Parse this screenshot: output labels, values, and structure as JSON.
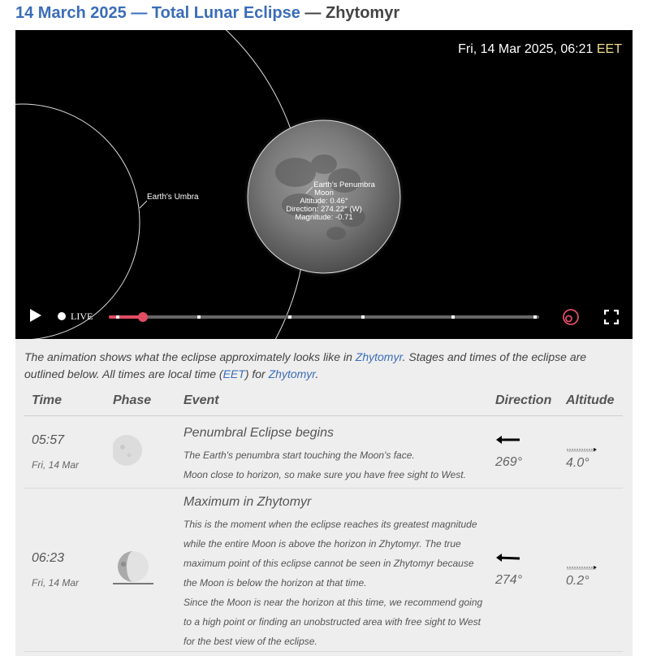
{
  "title": {
    "link_text": "14 March 2025 — Total Lunar Eclipse",
    "rest_text": " — Zhytomyr"
  },
  "player": {
    "datetime": "Fri, 14 Mar 2025, 06:21",
    "timezone": "EET",
    "umbra_label": "Earth's Umbra",
    "moon_label": "Moon",
    "penumbra_label": "Earth's Penumbra",
    "altitude": "Altitude: 0.46°",
    "direction": "Direction: 274.22° (W)",
    "magnitude": "Magnitude: -0.71",
    "live_label": "LIVE",
    "progress": 0.08,
    "stage_marks": [
      0.02,
      0.21,
      0.42,
      0.59,
      0.8,
      0.99
    ],
    "accent_color": "#e04d63"
  },
  "description": {
    "part1": "The animation shows what the eclipse approximately looks like in ",
    "city_link": "Zhytomyr",
    "part2": ". Stages and times of the eclipse are outlined below. All times are local time (",
    "tz_link": "EET",
    "part3": ") for ",
    "city_link2": "Zhytomyr",
    "part4": "."
  },
  "table": {
    "headers": [
      "Time",
      "Phase",
      "Event",
      "Direction",
      "Altitude"
    ],
    "rows": [
      {
        "time": "05:57",
        "date": "Fri, 14 Mar",
        "event_title": "Penumbral Eclipse begins",
        "event_lines": [
          "The Earth's penumbra start touching the Moon's face.",
          "Moon close to horizon, so make sure you have free sight to West."
        ],
        "direction": "269°",
        "altitude": "4.0°"
      },
      {
        "time": "06:23",
        "date": "Fri, 14 Mar",
        "event_title": "Maximum in Zhytomyr",
        "event_lines": [
          "This is the moment when the eclipse reaches its greatest magnitude while the entire Moon is above the horizon in Zhytomyr. The true maximum point of this eclipse cannot be seen in Zhytomyr because the Moon is below the horizon at that time.",
          "Since the Moon is near the horizon at this time, we recommend going to a high point or finding an unobstructed area with free sight to West for the best view of the eclipse."
        ],
        "direction": "274°",
        "altitude": "0.2°"
      }
    ]
  },
  "icons": {
    "play": "play-icon",
    "loop": "loop-icon",
    "fullscreen": "fullscreen-icon",
    "direction": "arrow-left-icon",
    "altitude": "altitude-indicator-icon",
    "phase": "moon-phase-icon"
  }
}
